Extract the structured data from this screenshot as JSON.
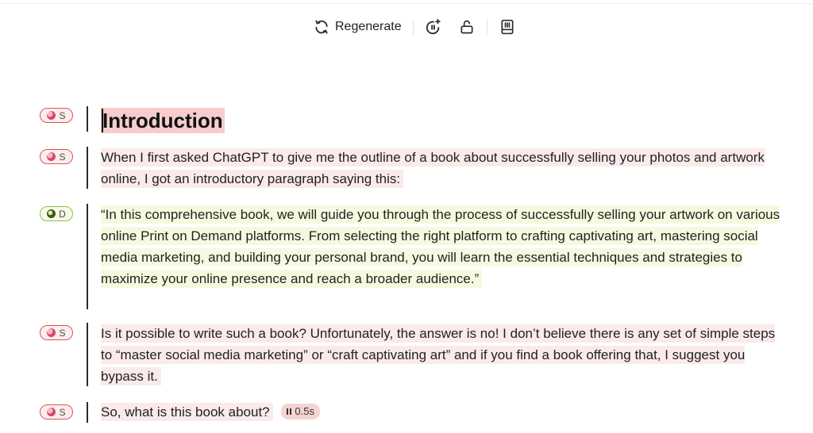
{
  "toolbar": {
    "regenerate_label": "Regenerate",
    "icons": [
      "refresh-icon",
      "sparkle-timer-icon",
      "unlock-icon",
      "book-icon"
    ]
  },
  "badges": {
    "s_label": "S",
    "d_label": "D"
  },
  "document": {
    "heading": "Introduction",
    "para1": "When I first asked ChatGPT to give me the outline of a book about successfully selling your photos and artwork online, I got an introductory paragraph saying this:",
    "quote": "“In this comprehensive book, we will guide you through the process of successfully selling your artwork on various online Print on Demand platforms. From selecting the right platform to crafting captivating art, mastering social media marketing, and building your personal brand, you will learn the essential techniques and strategies to maximize your online presence and reach a broader audience.”",
    "para3": "Is it possible to write such a book? Unfortunately, the answer is no! I don’t believe there is any set of simple steps to “master social media marketing” or “craft captivating art” and if you find a book offering that, I suggest you bypass it.",
    "para4": "So, what is this book about?",
    "timer": "0.5s"
  },
  "colors": {
    "human_badge_border": "#d9545a",
    "ai_badge_border": "#8fbf4e",
    "human_highlight": "#fbeaea",
    "ai_highlight": "#f4fadf",
    "heading_highlight": "#f6cccc"
  }
}
